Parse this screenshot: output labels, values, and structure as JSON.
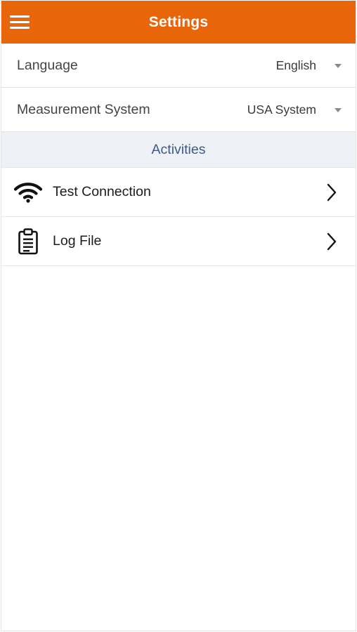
{
  "header": {
    "title": "Settings",
    "background_color": "#e8650a",
    "menu_icon": "hamburger-menu-icon"
  },
  "settings": {
    "language": {
      "label": "Language",
      "value": "English"
    },
    "measurement_system": {
      "label": "Measurement System",
      "value": "USA System"
    }
  },
  "activities": {
    "section_title": "Activities",
    "section_title_color": "#3d5a86",
    "items": [
      {
        "label": "Test Connection",
        "icon": "wifi-icon"
      },
      {
        "label": "Log File",
        "icon": "clipboard-icon"
      }
    ]
  }
}
